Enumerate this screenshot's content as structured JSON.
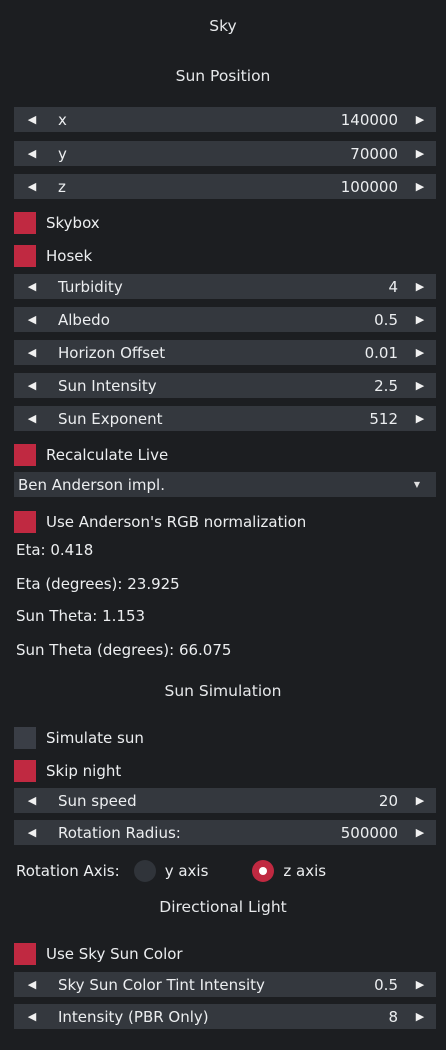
{
  "title": "Sky",
  "sections": {
    "sun_position": "Sun Position",
    "sun_simulation": "Sun Simulation",
    "directional_light": "Directional Light"
  },
  "arrows": {
    "left": "◀",
    "right": "▶"
  },
  "position": {
    "x": {
      "label": "x",
      "value": "140000"
    },
    "y": {
      "label": "y",
      "value": "70000"
    },
    "z": {
      "label": "z",
      "value": "100000"
    }
  },
  "skybox": {
    "label": "Skybox",
    "checked": true
  },
  "hosek": {
    "label": "Hosek",
    "checked": true
  },
  "turbidity": {
    "label": "Turbidity",
    "value": "4"
  },
  "albedo": {
    "label": "Albedo",
    "value": "0.5"
  },
  "horizon_offset": {
    "label": "Horizon Offset",
    "value": "0.01"
  },
  "sun_intensity": {
    "label": "Sun Intensity",
    "value": "2.5"
  },
  "sun_exponent": {
    "label": "Sun Exponent",
    "value": "512"
  },
  "recalculate_live": {
    "label": "Recalculate Live",
    "checked": true
  },
  "implementation": {
    "selected": "Ben Anderson impl.",
    "caret": "▼"
  },
  "anderson_rgb": {
    "label": "Use Anderson's RGB normalization",
    "checked": true
  },
  "info": {
    "eta": "Eta: 0.418",
    "eta_degrees": "Eta (degrees): 23.925",
    "sun_theta": "Sun Theta: 1.153",
    "sun_theta_degrees": "Sun Theta (degrees): 66.075"
  },
  "simulate_sun": {
    "label": "Simulate sun",
    "checked": false
  },
  "skip_night": {
    "label": "Skip night",
    "checked": true
  },
  "sun_speed": {
    "label": "Sun speed",
    "value": "20"
  },
  "rotation_radius": {
    "label": "Rotation Radius:",
    "value": "500000"
  },
  "rotation_axis": {
    "label": "Rotation Axis:",
    "options": [
      "y axis",
      "z axis"
    ],
    "selected": "z axis"
  },
  "use_sky_sun_color": {
    "label": "Use Sky Sun Color",
    "checked": true
  },
  "sky_sun_tint": {
    "label": "Sky Sun Color Tint Intensity",
    "value": "0.5"
  },
  "intensity_pbr": {
    "label": "Intensity (PBR Only)",
    "value": "8"
  },
  "colors": {
    "accent": "#c02941",
    "panel": "#1c1e21",
    "widget": "#34383e"
  }
}
